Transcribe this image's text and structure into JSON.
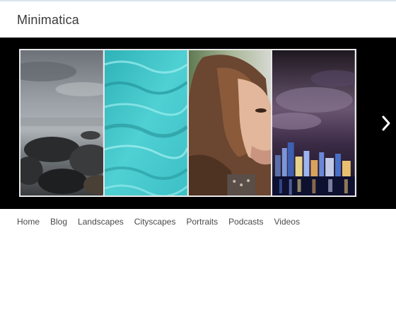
{
  "site": {
    "title": "Minimatica"
  },
  "slider": {
    "slides": [
      {
        "name": "rocky-shore-photo"
      },
      {
        "name": "turquoise-water-photo"
      },
      {
        "name": "portrait-woman-photo"
      },
      {
        "name": "city-night-skyline-photo"
      }
    ],
    "next_icon": "chevron-right-icon"
  },
  "nav": {
    "items": [
      "Home",
      "Blog",
      "Landscapes",
      "Cityscapes",
      "Portraits",
      "Podcasts",
      "Videos"
    ]
  },
  "colors": {
    "slider_bg": "#000000",
    "frame": "#e8e8e8",
    "nav_text": "#4a4a4a",
    "title_text": "#3a3a3a"
  }
}
